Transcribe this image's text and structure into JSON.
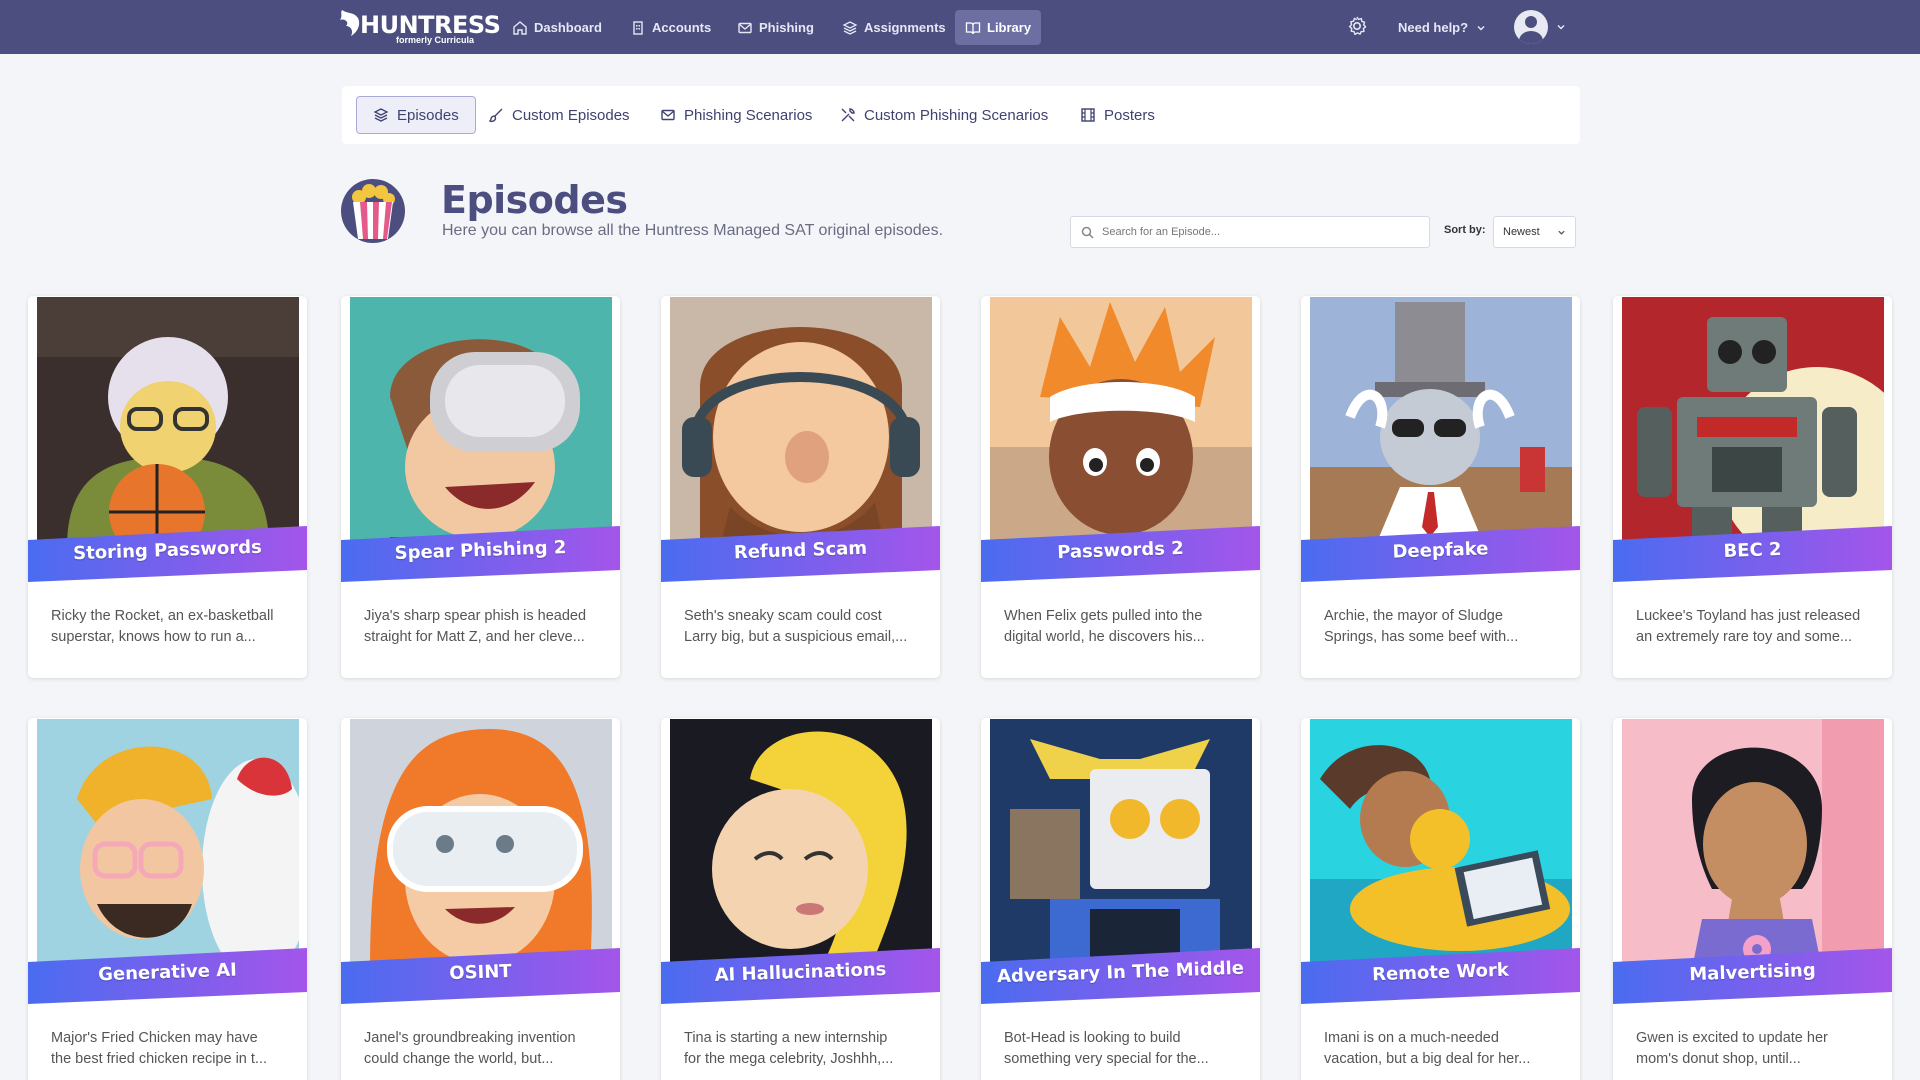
{
  "brand": {
    "name": "HUNTRESS",
    "tagline": "formerly Curricula"
  },
  "nav": {
    "items": [
      {
        "label": "Dashboard",
        "icon": "home-icon"
      },
      {
        "label": "Accounts",
        "icon": "building-icon"
      },
      {
        "label": "Phishing",
        "icon": "mail-icon"
      },
      {
        "label": "Assignments",
        "icon": "layers-icon"
      },
      {
        "label": "Library",
        "icon": "book-icon",
        "active": true
      }
    ],
    "help_label": "Need help?"
  },
  "tabs": [
    {
      "label": "Episodes",
      "icon": "layers-icon",
      "active": true
    },
    {
      "label": "Custom Episodes",
      "icon": "brush-icon"
    },
    {
      "label": "Phishing Scenarios",
      "icon": "mail-icon"
    },
    {
      "label": "Custom Phishing Scenarios",
      "icon": "tools-icon"
    },
    {
      "label": "Posters",
      "icon": "film-icon"
    }
  ],
  "header": {
    "title": "Episodes",
    "subtitle": "Here you can browse all the Huntress Managed SAT original episodes."
  },
  "search": {
    "placeholder": "Search for an Episode..."
  },
  "sort": {
    "label": "Sort by:",
    "value": "Newest"
  },
  "colors": {
    "nav_bg": "#4b4e7f",
    "ribbon_start": "#4a6cf0",
    "ribbon_end": "#a455ea"
  },
  "episodes": [
    {
      "title": "Storing Passwords",
      "desc1": "Ricky the Rocket, an ex-basketball",
      "desc2": "superstar, knows how to run a..."
    },
    {
      "title": "Spear Phishing 2",
      "desc1": "Jiya's sharp spear phish is headed",
      "desc2": "straight for Matt Z, and her cleve..."
    },
    {
      "title": "Refund Scam",
      "desc1": "Seth's sneaky scam could cost",
      "desc2": "Larry big, but a suspicious email,..."
    },
    {
      "title": "Passwords 2",
      "desc1": "When Felix gets pulled into the",
      "desc2": "digital world, he discovers his..."
    },
    {
      "title": "Deepfake",
      "desc1": "Archie, the mayor of Sludge",
      "desc2": "Springs, has some beef with..."
    },
    {
      "title": "BEC 2",
      "desc1": "Luckee's Toyland has just released",
      "desc2": "an extremely rare toy and some..."
    },
    {
      "title": "Generative AI",
      "desc1": "Major's Fried Chicken may have",
      "desc2": "the best fried chicken recipe in t..."
    },
    {
      "title": "OSINT",
      "desc1": "Janel's groundbreaking invention",
      "desc2": "could change the world, but..."
    },
    {
      "title": "AI Hallucinations",
      "desc1": "Tina is starting a new internship",
      "desc2": "for the mega celebrity, Joshhh,..."
    },
    {
      "title": "Adversary In The Middle",
      "desc1": "Bot-Head is looking to build",
      "desc2": "something very special for the..."
    },
    {
      "title": "Remote Work",
      "desc1": "Imani is on a much-needed",
      "desc2": "vacation, but a big deal for her..."
    },
    {
      "title": "Malvertising",
      "desc1": "Gwen is excited to update her",
      "desc2": "mom's donut shop, until..."
    }
  ]
}
